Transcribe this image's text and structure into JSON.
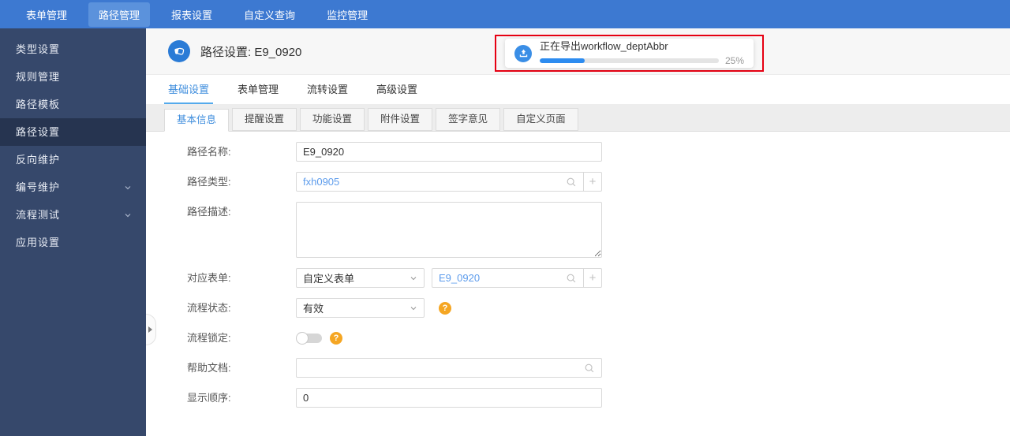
{
  "topnav": {
    "items": [
      {
        "label": "表单管理",
        "active": false
      },
      {
        "label": "路径管理",
        "active": true
      },
      {
        "label": "报表设置",
        "active": false
      },
      {
        "label": "自定义查询",
        "active": false
      },
      {
        "label": "监控管理",
        "active": false
      }
    ]
  },
  "sidebar": {
    "items": [
      {
        "label": "类型设置",
        "selected": false,
        "expandable": false
      },
      {
        "label": "规则管理",
        "selected": false,
        "expandable": false
      },
      {
        "label": "路径模板",
        "selected": false,
        "expandable": false
      },
      {
        "label": "路径设置",
        "selected": true,
        "expandable": false
      },
      {
        "label": "反向维护",
        "selected": false,
        "expandable": false
      },
      {
        "label": "编号维护",
        "selected": false,
        "expandable": true
      },
      {
        "label": "流程测试",
        "selected": false,
        "expandable": true
      },
      {
        "label": "应用设置",
        "selected": false,
        "expandable": false
      }
    ]
  },
  "header": {
    "title": "路径设置: E9_0920"
  },
  "toast": {
    "message": "正在导出workflow_deptAbbr",
    "percent_label": "25%",
    "progress_percent": 25,
    "accent_color": "#2d8cf0"
  },
  "main_tabs": {
    "items": [
      {
        "label": "基础设置",
        "active": true
      },
      {
        "label": "表单管理",
        "active": false
      },
      {
        "label": "流转设置",
        "active": false
      },
      {
        "label": "高级设置",
        "active": false
      }
    ]
  },
  "sub_tabs": {
    "items": [
      {
        "label": "基本信息",
        "active": true
      },
      {
        "label": "提醒设置",
        "active": false
      },
      {
        "label": "功能设置",
        "active": false
      },
      {
        "label": "附件设置",
        "active": false
      },
      {
        "label": "签字意见",
        "active": false
      },
      {
        "label": "自定义页面",
        "active": false
      }
    ]
  },
  "form": {
    "path_name": {
      "label": "路径名称:",
      "value": "E9_0920"
    },
    "path_type": {
      "label": "路径类型:",
      "value": "fxh0905"
    },
    "path_desc": {
      "label": "路径描述:",
      "value": ""
    },
    "form_binding": {
      "label": "对应表单:",
      "select_value": "自定义表单",
      "value": "E9_0920"
    },
    "flow_status": {
      "label": "流程状态:",
      "select_value": "有效"
    },
    "flow_lock": {
      "label": "流程锁定:",
      "toggle_on": false
    },
    "help_doc": {
      "label": "帮助文档:",
      "value": ""
    },
    "display_order": {
      "label": "显示顺序:",
      "value": "0"
    }
  },
  "icons": {
    "plus_glyph": "+",
    "help_glyph": "?"
  },
  "colors": {
    "topnav_bg": "#3d79d1",
    "topnav_active_bg": "#5b92dc",
    "sidebar_bg": "#36486b",
    "sidebar_selected_bg": "#263450",
    "tab_active": "#3e8ddd",
    "link_blue": "#5d9cec",
    "annotation_red": "#e60012",
    "help_orange": "#f5a623",
    "progress_blue": "#2d8cf0"
  }
}
